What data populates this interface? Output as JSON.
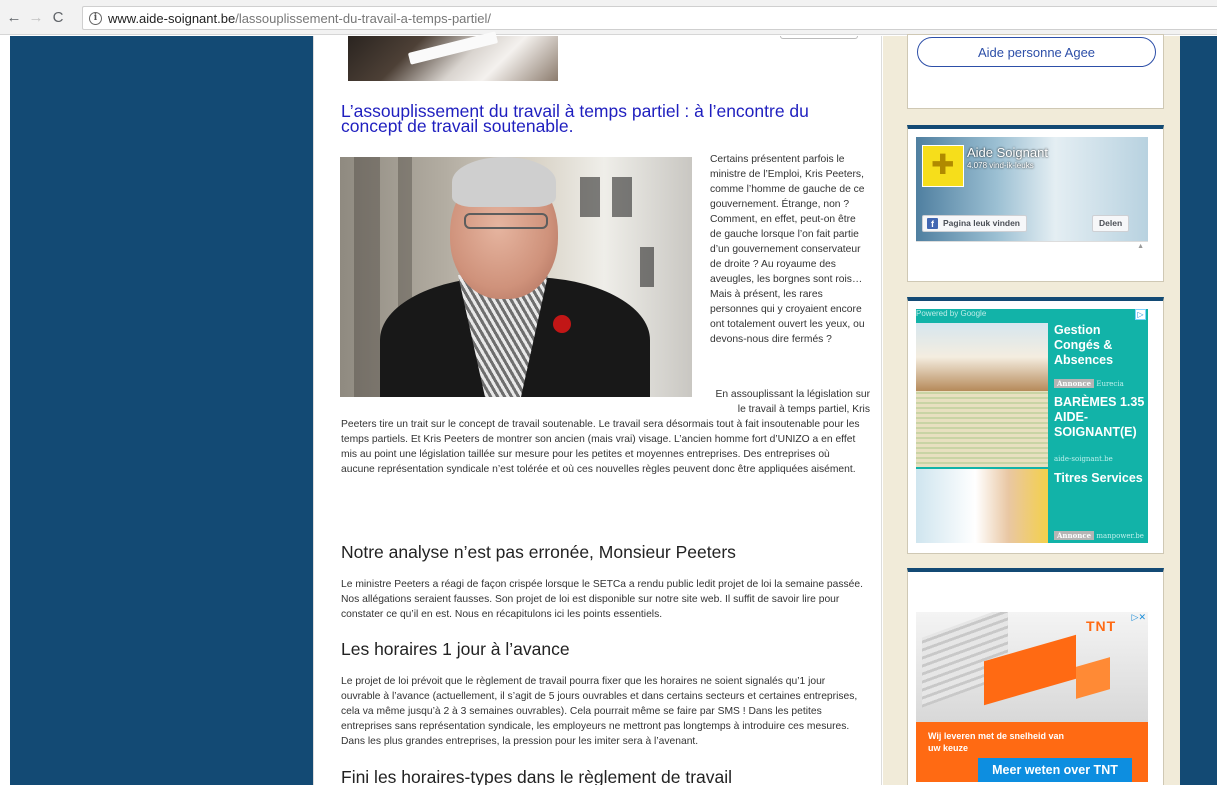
{
  "browser": {
    "back": "←",
    "forward": "→",
    "reload": "C",
    "info": "i",
    "url_host": "www.aide-soignant.be",
    "url_path": "/lassouplissement-du-travail-a-temps-partiel/"
  },
  "article": {
    "title": "L’assouplissement du travail à temps partiel : à l’encontre du concept de travail soutenable.",
    "float_paragraph_1": "Certains présentent parfois le ministre de l’Emploi, Kris Peeters, comme l’homme de gauche de ce gouvernement. Étrange, non ? Comment, en effet, peut-on être de gauche lorsque l’on fait partie d’un gouvernement conservateur de droite ? Au royaume des aveugles, les borgnes sont rois… Mais à présent, les rares personnes qui y croyaient encore ont totalement ouvert les yeux, ou devons-nous dire fermés ?",
    "float_paragraph_2_start": "En assouplissant la législation sur le travail à temps partiel, Kris",
    "paragraph_2_rest": "Peeters tire un trait sur le concept de travail soutenable. Le travail sera désormais tout à fait insoutenable pour les temps partiels. Et Kris Peeters de montrer son ancien (mais vrai) visage. L’ancien homme fort d’UNIZO a en effet mis au point une législation taillée sur mesure pour les petites et moyennes entreprises. Des entreprises où aucune représentation syndicale n’est tolérée et où ces nouvelles règles peuvent donc être appliquées aisément.",
    "section_1_heading": "Notre analyse n’est pas erronée, Monsieur Peeters",
    "section_1_text": "Le ministre Peeters a réagi de façon crispée lorsque le SETCa a rendu public ledit projet de loi la semaine passée. Nos allégations seraient fausses. Son projet de loi est disponible sur notre site web. Il suffit de savoir lire pour constater ce qu’il en est. Nous en récapitulons ici les points essentiels.",
    "section_2_heading": "Les horaires 1 jour à l’avance",
    "section_2_text": "Le projet de loi prévoit que le règlement de travail pourra fixer que les horaires ne soient signalés qu’1 jour ouvrable à l’avance (actuellement, il s’agit de 5 jours ouvrables et dans certains secteurs et certaines entreprises, cela va même jusqu’à 2 à 3 semaines ouvrables). Cela pourrait même se faire par SMS ! Dans les petites entreprises sans représentation syndicale, les employeurs ne mettront pas longtemps à introduire ces mesures. Dans les plus grandes entreprises, la pression pour les imiter sera à l’avenant.",
    "section_3_heading": "Fini les horaires-types dans le règlement de travail"
  },
  "sidebar": {
    "pill_button": "Aide personne Agee",
    "facebook": {
      "page_name": "Aide Soignant",
      "likes": "4.078 vind-ik-leuks",
      "like_button": "Pagina leuk vinden",
      "share_button": "Delen"
    },
    "ads": {
      "powered_by": "Powered by Google",
      "items": [
        {
          "title": "Gestion Congés & Absences",
          "tag": "Annonce",
          "source": "Eurecia"
        },
        {
          "title": "BARÈMES 1.35 AIDE-SOIGNANT(E)",
          "source": "aide-soignant.be"
        },
        {
          "title": "Titres Services",
          "tag": "Annonce",
          "source": "manpower.be"
        }
      ]
    },
    "banner": {
      "brand": "TNT",
      "text": "Wij leveren met de snelheid van uw keuze",
      "cta": "Meer weten over TNT"
    }
  },
  "colors": {
    "page_bg": "#134a74",
    "sidebar_bg": "#f1ebd9",
    "title_blue": "#1f1fbf",
    "ad_teal": "#12b3a8",
    "tnt_orange": "#ff6a13"
  }
}
